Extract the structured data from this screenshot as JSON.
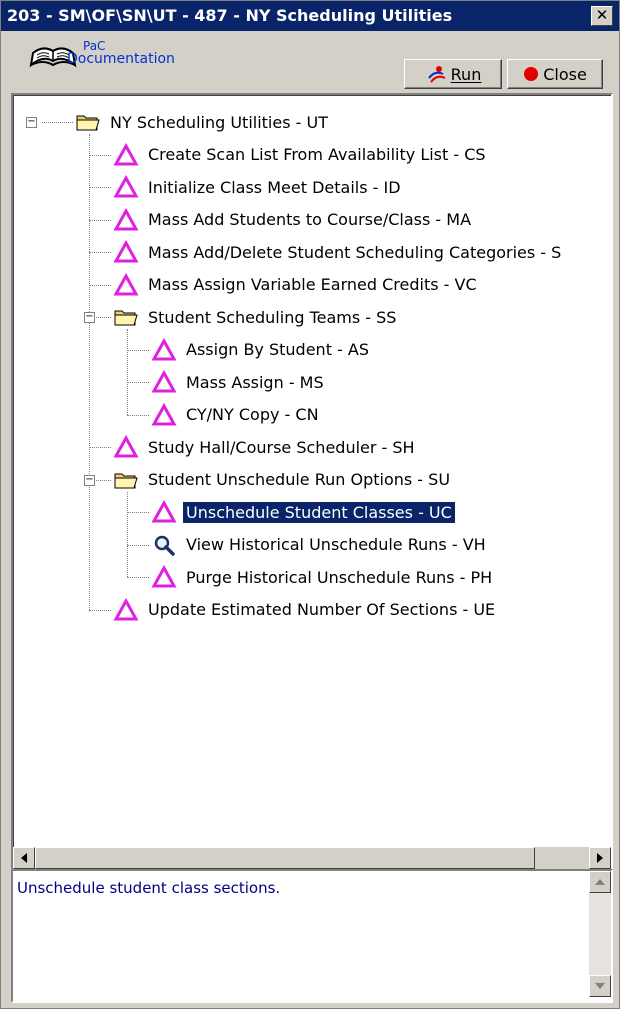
{
  "window": {
    "title": "203 - SM\\OF\\SN\\UT - 487 - NY Scheduling Utilities",
    "close_glyph": "✕"
  },
  "toolbar": {
    "pac_top": "PaC",
    "pac_bottom": "Documentation",
    "run_label": "Run",
    "close_label": "Close"
  },
  "tree": {
    "root": "NY Scheduling Utilities - UT",
    "items": [
      {
        "label": "Create Scan List From Availability List - CS",
        "icon": "triangle-icon"
      },
      {
        "label": "Initialize Class Meet Details - ID",
        "icon": "triangle-icon"
      },
      {
        "label": "Mass Add Students to Course/Class - MA",
        "icon": "triangle-icon"
      },
      {
        "label": "Mass Add/Delete Student Scheduling Categories - S",
        "icon": "triangle-icon"
      },
      {
        "label": "Mass Assign Variable Earned Credits - VC",
        "icon": "triangle-icon"
      },
      {
        "label": "Student Scheduling Teams - SS",
        "icon": "folder-icon"
      },
      {
        "label": "Assign By Student - AS",
        "icon": "triangle-icon"
      },
      {
        "label": "Mass Assign - MS",
        "icon": "triangle-icon"
      },
      {
        "label": "CY/NY Copy - CN",
        "icon": "triangle-icon"
      },
      {
        "label": "Study Hall/Course Scheduler - SH",
        "icon": "triangle-icon"
      },
      {
        "label": "Student Unschedule Run Options - SU",
        "icon": "folder-icon"
      },
      {
        "label": "Unschedule Student Classes - UC",
        "icon": "triangle-icon"
      },
      {
        "label": "View Historical Unschedule Runs - VH",
        "icon": "magnifier-icon"
      },
      {
        "label": "Purge Historical Unschedule Runs - PH",
        "icon": "triangle-icon"
      },
      {
        "label": "Update Estimated Number Of Sections - UE",
        "icon": "triangle-icon"
      }
    ],
    "selected_index": 11
  },
  "description": {
    "text": "Unschedule student class sections."
  },
  "colors": {
    "title_bg": "#0a246a",
    "triangle": "#e020e0",
    "folder": "#f0d060",
    "record": "#e00000"
  }
}
